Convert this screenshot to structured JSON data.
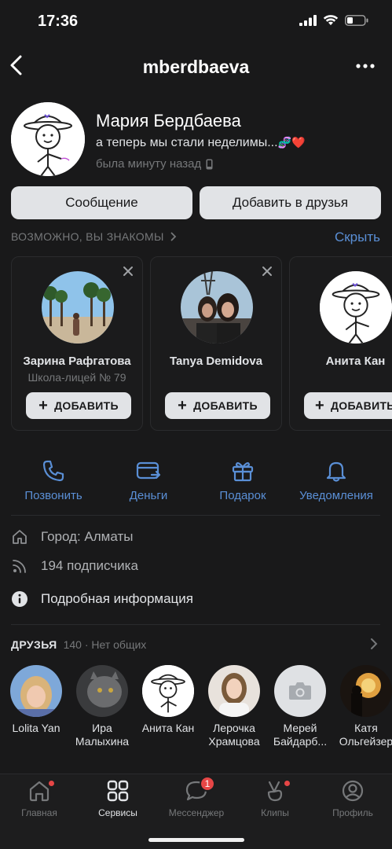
{
  "status_bar": {
    "time": "17:36"
  },
  "header": {
    "title": "mberdbaeva"
  },
  "profile": {
    "name": "Мария Бердбаева",
    "status": "а теперь мы стали неделимы...",
    "status_emoji": "🧬❤️",
    "last_seen": "была минуту назад"
  },
  "buttons": {
    "message": "Сообщение",
    "add_friend": "Добавить в друзья"
  },
  "suggestions": {
    "title": "ВОЗМОЖНО, ВЫ ЗНАКОМЫ",
    "hide": "Скрыть",
    "cards": [
      {
        "name": "Зарина Рафгатова",
        "subtitle": "Школа-лицей № 79",
        "button": "ДОБАВИТЬ"
      },
      {
        "name": "Tanya Demidova",
        "subtitle": "",
        "button": "ДОБАВИТЬ"
      },
      {
        "name": "Анита Кан",
        "subtitle": "",
        "button": "ДОБАВИТЬ"
      }
    ]
  },
  "actions": [
    {
      "label": "Позвонить",
      "icon": "phone-icon"
    },
    {
      "label": "Деньги",
      "icon": "card-icon"
    },
    {
      "label": "Подарок",
      "icon": "gift-icon"
    },
    {
      "label": "Уведомления",
      "icon": "bell-icon"
    }
  ],
  "info": {
    "city": "Город: Алматы",
    "followers": "194 подписчика",
    "details": "Подробная информация"
  },
  "friends": {
    "title": "ДРУЗЬЯ",
    "count": "140 · Нет общих",
    "items": [
      {
        "name_line1": "Lolita Yan",
        "name_line2": ""
      },
      {
        "name_line1": "Ира",
        "name_line2": "Малыхина"
      },
      {
        "name_line1": "Анита Кан",
        "name_line2": ""
      },
      {
        "name_line1": "Лерочка",
        "name_line2": "Храмцова"
      },
      {
        "name_line1": "Мерей",
        "name_line2": "Байдарб..."
      },
      {
        "name_line1": "Катя",
        "name_line2": "Ольгейзер"
      }
    ]
  },
  "tabbar": {
    "items": [
      {
        "label": "Главная",
        "icon": "home-icon"
      },
      {
        "label": "Сервисы",
        "icon": "services-icon"
      },
      {
        "label": "Мессенджер",
        "icon": "messenger-icon",
        "badge": "1"
      },
      {
        "label": "Клипы",
        "icon": "clips-icon"
      },
      {
        "label": "Профиль",
        "icon": "profile-icon"
      }
    ]
  },
  "colors": {
    "accent": "#5a8fd6",
    "background": "#19191a",
    "badge": "#e64646"
  }
}
